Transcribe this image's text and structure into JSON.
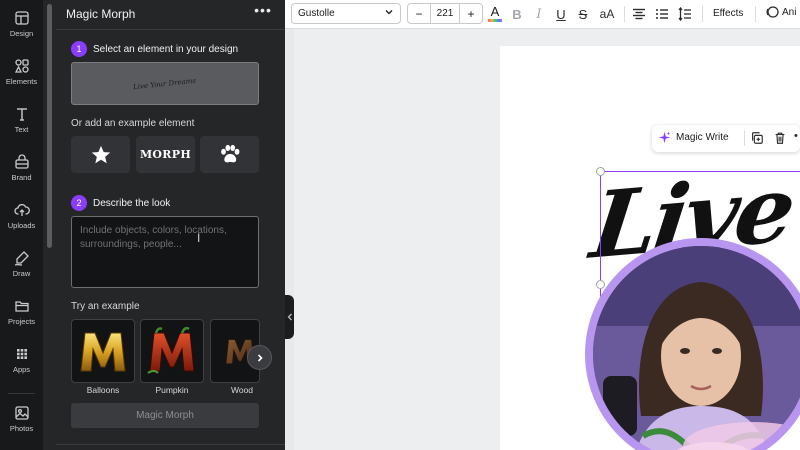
{
  "sidebar": {
    "items": [
      {
        "label": "Design",
        "icon": "layout-icon"
      },
      {
        "label": "Elements",
        "icon": "shapes-icon"
      },
      {
        "label": "Text",
        "icon": "text-icon"
      },
      {
        "label": "Brand",
        "icon": "brand-icon"
      },
      {
        "label": "Uploads",
        "icon": "cloud-upload-icon"
      },
      {
        "label": "Draw",
        "icon": "pen-icon"
      },
      {
        "label": "Projects",
        "icon": "folder-icon"
      },
      {
        "label": "Apps",
        "icon": "apps-grid-icon"
      },
      {
        "label": "Photos",
        "icon": "image-icon"
      }
    ]
  },
  "panel": {
    "title": "Magic Morph",
    "step1": {
      "number": "1",
      "label": "Select an element in your design"
    },
    "selected_element_text": "Live Your Dreams",
    "or_label": "Or add an example element",
    "examples": [
      {
        "name": "star",
        "label": ""
      },
      {
        "name": "morph-text",
        "label": "MORPH"
      },
      {
        "name": "paw",
        "label": ""
      }
    ],
    "step2": {
      "number": "2",
      "label": "Describe the look"
    },
    "describe_placeholder": "Include objects, colors, locations, surroundings, people...",
    "try_label": "Try an example",
    "try_examples": [
      {
        "label": "Balloons",
        "letter": "M"
      },
      {
        "label": "Pumpkin",
        "letter": "M"
      },
      {
        "label": "Wood",
        "letter": "M"
      }
    ],
    "button_label": "Magic Morph"
  },
  "toolbar": {
    "font": "Gustolle",
    "font_size": "221",
    "minus": "−",
    "plus": "+",
    "text_color_letter": "A",
    "bold": "B",
    "italic": "I",
    "underline": "U",
    "strikethrough": "S",
    "case": "aA",
    "effects": "Effects",
    "animate": "Ani"
  },
  "canvas": {
    "magic_write": "Magic Write",
    "text_element": "Live Yo"
  },
  "colors": {
    "accent": "#8b3dff",
    "panel_bg": "#252627",
    "rail_bg": "#18191b"
  }
}
